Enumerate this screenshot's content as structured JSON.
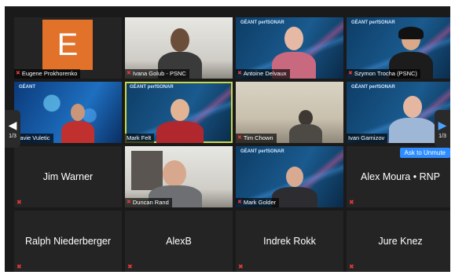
{
  "navigation": {
    "left_arrow": "◀",
    "right_arrow": "▶",
    "left_page": "1/3",
    "right_page": "1/3"
  },
  "tooltip": {
    "ask_to_unmute": "Ask to Unmute"
  },
  "tiles": [
    {
      "name": "Eugene Prokhorenko",
      "initial": "E",
      "muted": true
    },
    {
      "name": "Ivana Golub - PSNC",
      "muted": true
    },
    {
      "name": "Antoine Delvaux",
      "muted": true,
      "logo": "GÉANT perfSONAR"
    },
    {
      "name": "Szymon Trocha (PSNC)",
      "muted": true,
      "logo": "GÉANT perfSONAR"
    },
    {
      "name": "Davie Vuletic",
      "muted": false,
      "logo": "GÉANT"
    },
    {
      "name": "Mark Felt",
      "muted": false,
      "logo": "GÉANT perfSONAR",
      "active": true
    },
    {
      "name": "Tim Chown",
      "muted": true
    },
    {
      "name": "Ivan Garnizov",
      "muted": false,
      "logo": "GÉANT perfSONAR"
    },
    {
      "name": "Jim Warner",
      "muted": true,
      "video": false
    },
    {
      "name": "Duncan Rand",
      "muted": true
    },
    {
      "name": "Mark Golder",
      "muted": true,
      "logo": "GÉANT perfSONAR"
    },
    {
      "name": "Alex Moura • RNP",
      "muted": true,
      "video": false
    },
    {
      "name": "Ralph Niederberger",
      "muted": true,
      "video": false
    },
    {
      "name": "AlexB",
      "muted": true,
      "video": false
    },
    {
      "name": "Indrek Rokk",
      "muted": true,
      "video": false
    },
    {
      "name": "Jure Knez",
      "muted": true,
      "video": false
    }
  ],
  "icons": {
    "muted_mic": "mic-muted-icon"
  },
  "colors": {
    "accent": "#2d8cff",
    "active_border": "#c9d84a",
    "muted": "#e23b3b"
  }
}
